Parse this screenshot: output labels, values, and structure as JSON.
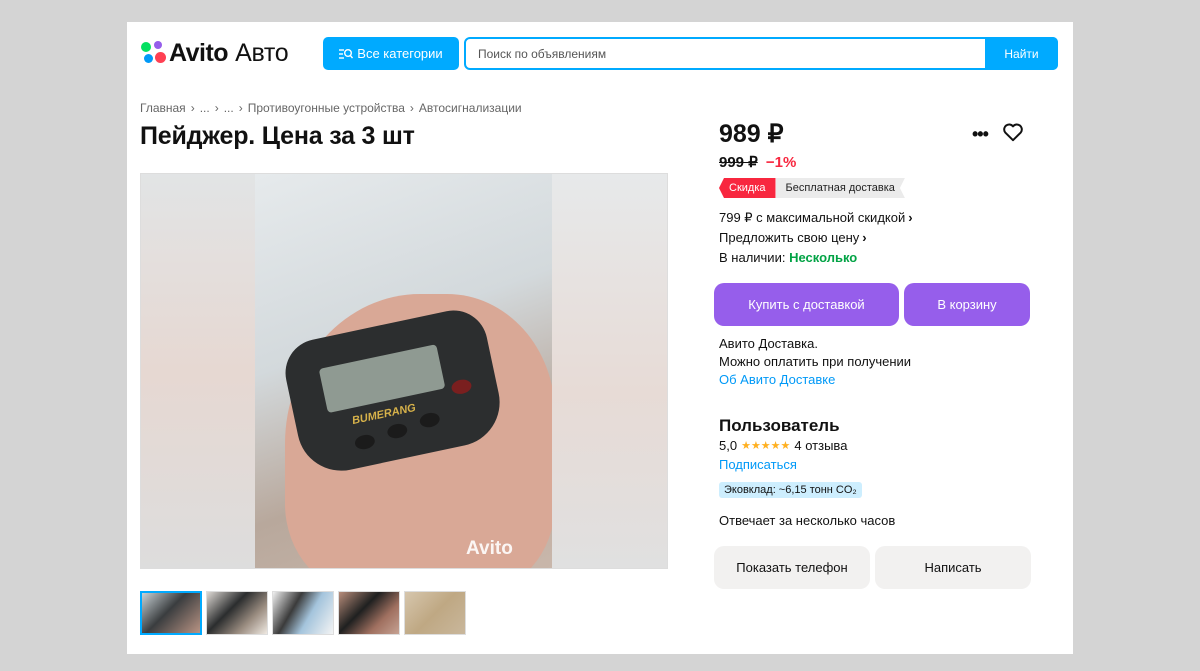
{
  "header": {
    "logo_brand": "Avito",
    "logo_sub": "Авто",
    "categories_label": "Все категории",
    "search_placeholder": "Поиск по объявлениям",
    "search_button": "Найти"
  },
  "breadcrumb": [
    "Главная",
    "...",
    "...",
    "Противоугонные устройства",
    "Автосигнализации"
  ],
  "breadcrumb_sep": "›",
  "listing": {
    "title": "Пейджер. Цена за 3 шт",
    "watermark": "Avito",
    "pager_brand": "BUMERANG",
    "thumbnail_count": 5
  },
  "price": {
    "current": "989 ₽",
    "old": "999 ₽",
    "discount": "−1%",
    "badge_sale": "Скидка",
    "badge_delivery": "Бесплатная доставка",
    "max_discount": "799 ₽ с максимальной скидкой",
    "offer_price": "Предложить свою цену",
    "availability_label": "В наличии:",
    "availability_value": "Несколько"
  },
  "actions": {
    "more": "•••",
    "buy_delivery": "Купить с доставкой",
    "to_cart": "В корзину"
  },
  "delivery": {
    "line1": "Авито Доставка.",
    "line2": "Можно оплатить при получении",
    "link": "Об Авито Доставке"
  },
  "seller": {
    "name": "Пользователь",
    "rating": "5,0",
    "stars": "★★★★★",
    "reviews": "4 отзыва",
    "subscribe": "Подписаться",
    "eco": "Эковклад: ~6,15 тонн CO₂",
    "response": "Отвечает за несколько часов",
    "show_phone": "Показать телефон",
    "write": "Написать"
  },
  "colors": {
    "accent_blue": "#00aaff",
    "purple": "#965eeb",
    "sale_red": "#f8273f",
    "green": "#02a345",
    "star": "#ffb021"
  }
}
